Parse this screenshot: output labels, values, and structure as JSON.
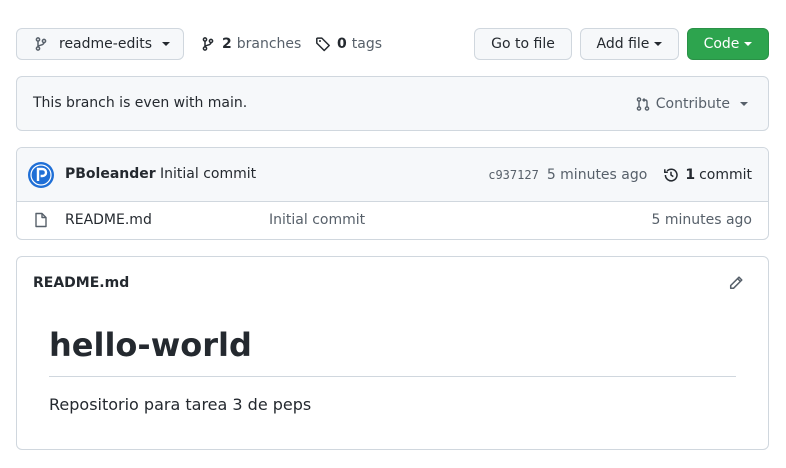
{
  "toolbar": {
    "branch_name": "readme-edits",
    "branches_count": "2",
    "branches_label": "branches",
    "tags_count": "0",
    "tags_label": "tags",
    "go_to_file": "Go to file",
    "add_file": "Add file",
    "code": "Code"
  },
  "branch_status": {
    "message": "This branch is even with main.",
    "contribute": "Contribute"
  },
  "latest_commit": {
    "author": "PBoleander",
    "message": "Initial commit",
    "sha": "c937127",
    "age": "5 minutes ago",
    "count": "1",
    "count_label": "commit"
  },
  "files": [
    {
      "name": "README.md",
      "commit_message": "Initial commit",
      "age": "5 minutes ago"
    }
  ],
  "readme": {
    "title": "README.md",
    "heading": "hello-world",
    "paragraph": "Repositorio para tarea 3 de peps"
  },
  "colors": {
    "primary_button": "#2da44e",
    "avatar": "#1f6fd6",
    "border": "#d0d7de",
    "muted_text": "#57606a"
  },
  "icons": {
    "branch": "git-branch-icon",
    "tag": "tag-icon",
    "pull_request": "git-pull-request-icon",
    "history": "history-icon",
    "file": "file-icon",
    "edit": "pencil-icon"
  }
}
